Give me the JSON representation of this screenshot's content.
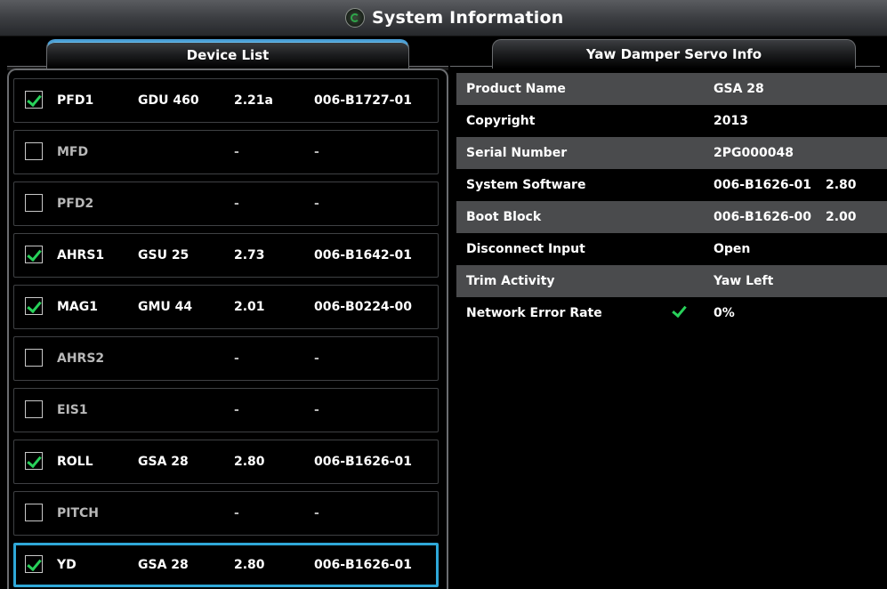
{
  "window": {
    "title": "System Information",
    "app_icon": "system-status-icon"
  },
  "tabs": [
    {
      "label": "Device List",
      "active": true
    },
    {
      "label": "Yaw Damper Servo Info",
      "active": false
    }
  ],
  "colors": {
    "accent": "#2fa8d8",
    "check": "#28d15a",
    "row_shade": "#4a4b4d"
  },
  "device_list": {
    "rows": [
      {
        "checked": true,
        "name": "PFD1",
        "model": "GDU 460",
        "version": "2.21a",
        "part": "006-B1727-01"
      },
      {
        "checked": false,
        "name": "MFD",
        "model": "",
        "version": "-",
        "part": "-"
      },
      {
        "checked": false,
        "name": "PFD2",
        "model": "",
        "version": "-",
        "part": "-"
      },
      {
        "checked": true,
        "name": "AHRS1",
        "model": "GSU 25",
        "version": "2.73",
        "part": "006-B1642-01"
      },
      {
        "checked": true,
        "name": "MAG1",
        "model": "GMU 44",
        "version": "2.01",
        "part": "006-B0224-00"
      },
      {
        "checked": false,
        "name": "AHRS2",
        "model": "",
        "version": "-",
        "part": "-"
      },
      {
        "checked": false,
        "name": "EIS1",
        "model": "",
        "version": "-",
        "part": "-"
      },
      {
        "checked": true,
        "name": "ROLL",
        "model": "GSA 28",
        "version": "2.80",
        "part": "006-B1626-01"
      },
      {
        "checked": false,
        "name": "PITCH",
        "model": "",
        "version": "-",
        "part": "-"
      },
      {
        "checked": true,
        "name": "YD",
        "model": "GSA 28",
        "version": "2.80",
        "part": "006-B1626-01",
        "selected": true
      }
    ]
  },
  "servo_info": {
    "rows": [
      {
        "label": "Product Name",
        "value": "GSA 28",
        "value2": ""
      },
      {
        "label": "Copyright",
        "value": "2013",
        "value2": ""
      },
      {
        "label": "Serial Number",
        "value": "2PG000048",
        "value2": ""
      },
      {
        "label": "System Software",
        "value": "006-B1626-01",
        "value2": "2.80"
      },
      {
        "label": "Boot Block",
        "value": "006-B1626-00",
        "value2": "2.00"
      },
      {
        "label": "Disconnect Input",
        "value": "Open",
        "value2": ""
      },
      {
        "label": "Trim Activity",
        "value": "Yaw Left",
        "value2": ""
      },
      {
        "label": "Network Error Rate",
        "value": "0%",
        "value2": "",
        "status_icon": "check-icon"
      }
    ]
  }
}
